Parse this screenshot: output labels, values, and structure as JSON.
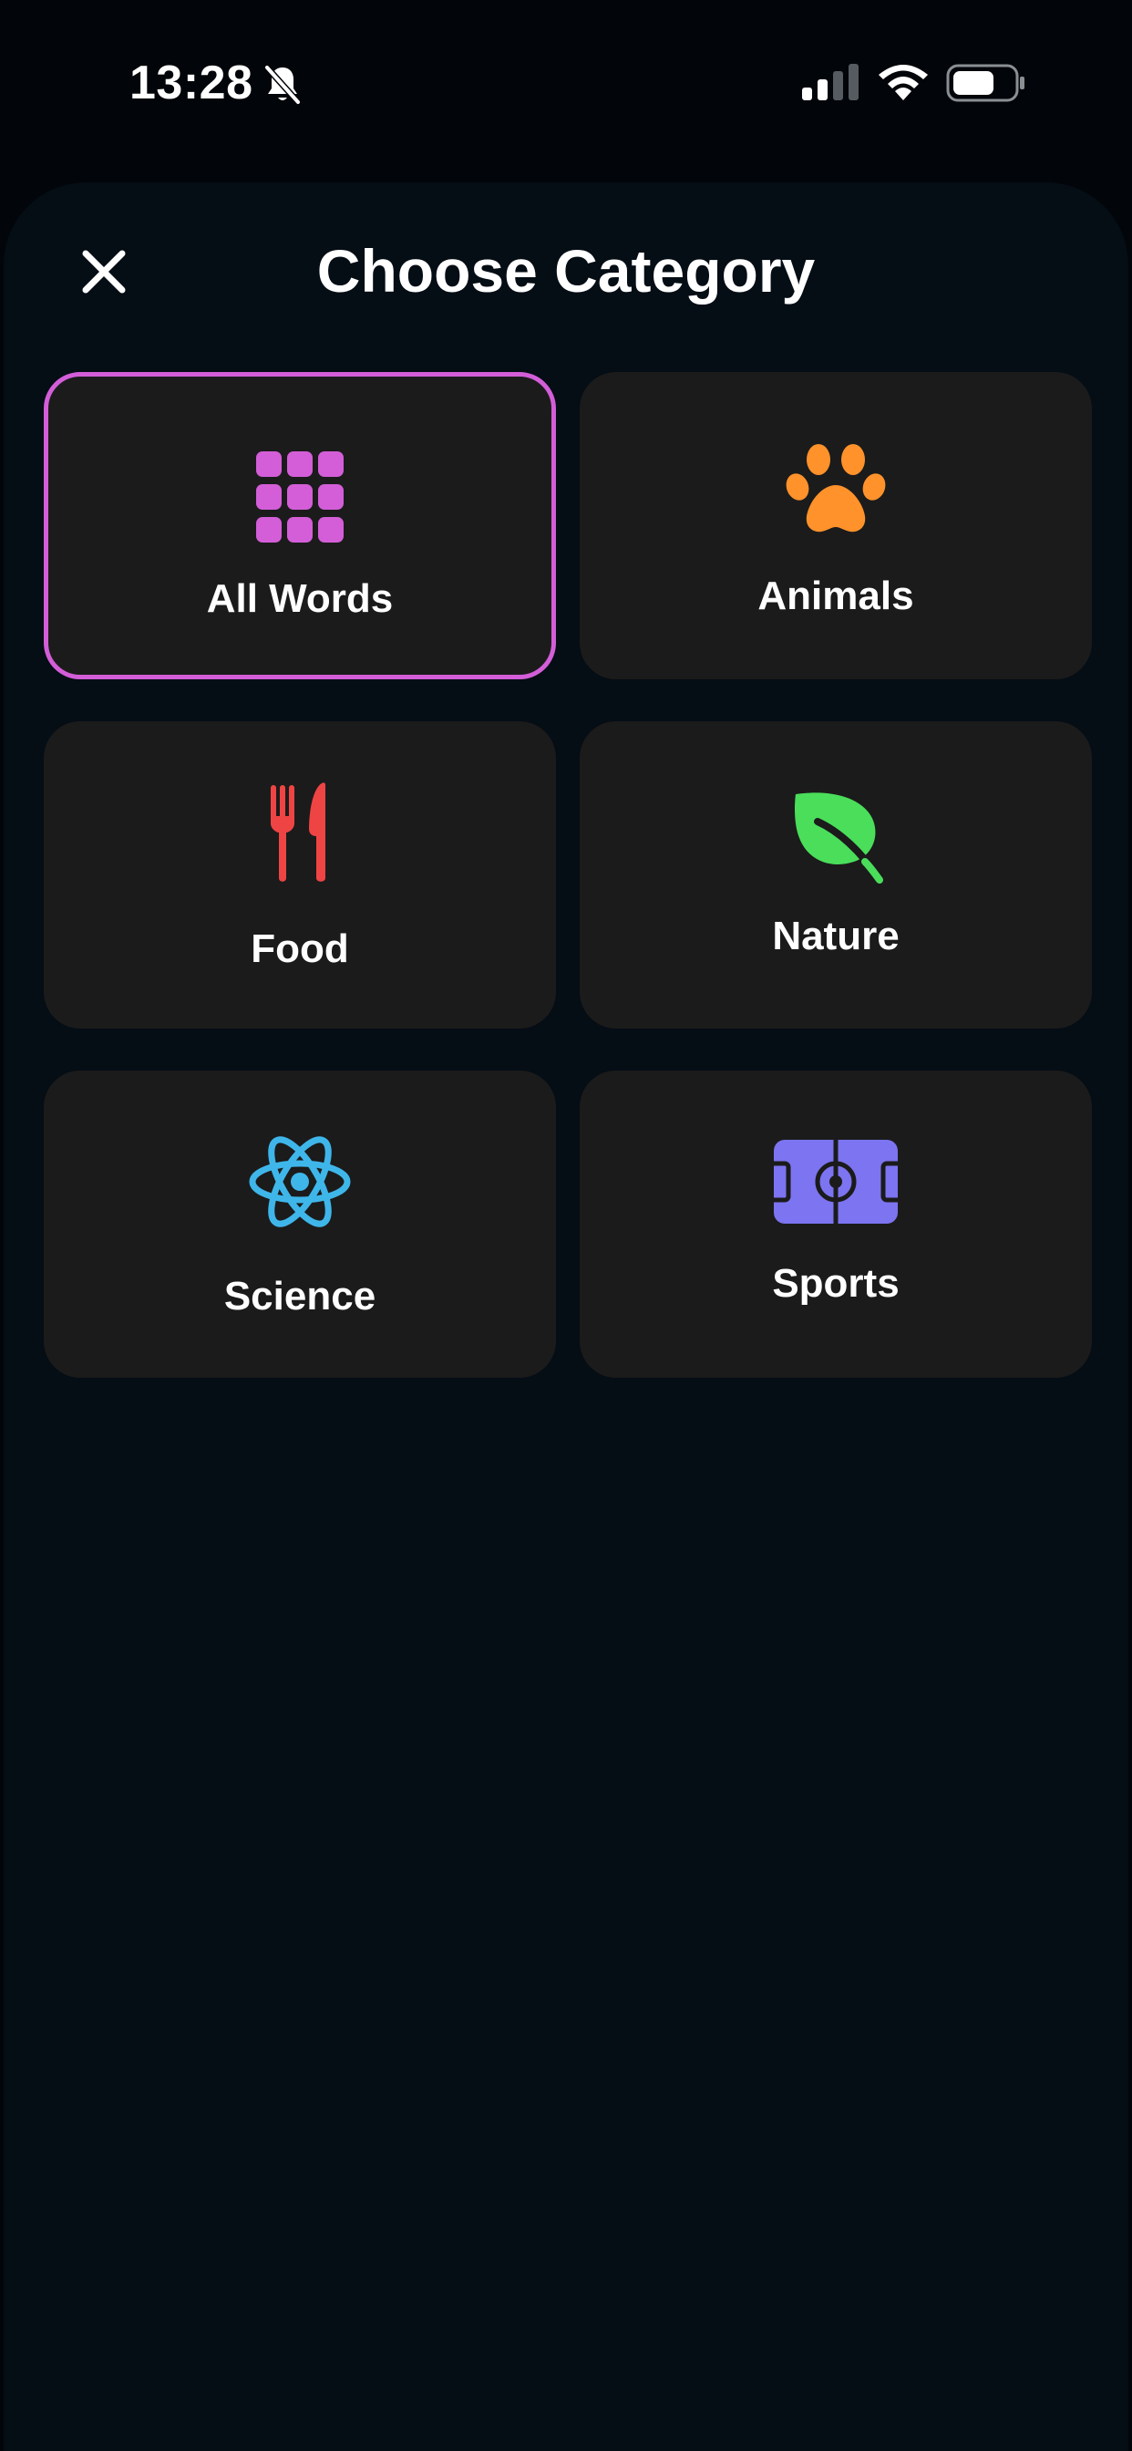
{
  "status_bar": {
    "time": "13:28",
    "icons": [
      "bell-slash-icon",
      "cellular-signal-icon",
      "wifi-icon",
      "battery-icon"
    ]
  },
  "header": {
    "title": "Choose Category",
    "close_icon": "close-icon"
  },
  "categories": [
    {
      "label": "All Words",
      "icon": "grid-icon",
      "color": "#d35ed8",
      "selected": true
    },
    {
      "label": "Animals",
      "icon": "paw-icon",
      "color": "#ff922b",
      "selected": false
    },
    {
      "label": "Food",
      "icon": "fork-knife-icon",
      "color": "#ef4444",
      "selected": false
    },
    {
      "label": "Nature",
      "icon": "leaf-icon",
      "color": "#4ade5a",
      "selected": false
    },
    {
      "label": "Science",
      "icon": "atom-icon",
      "color": "#3fb6ea",
      "selected": false
    },
    {
      "label": "Sports",
      "icon": "soccer-field-icon",
      "color": "#7c74f0",
      "selected": false
    }
  ],
  "colors": {
    "background": "#020509",
    "sheet": "#050d15",
    "card": "#1b1b1b",
    "selected_border": "#d35ed8"
  }
}
